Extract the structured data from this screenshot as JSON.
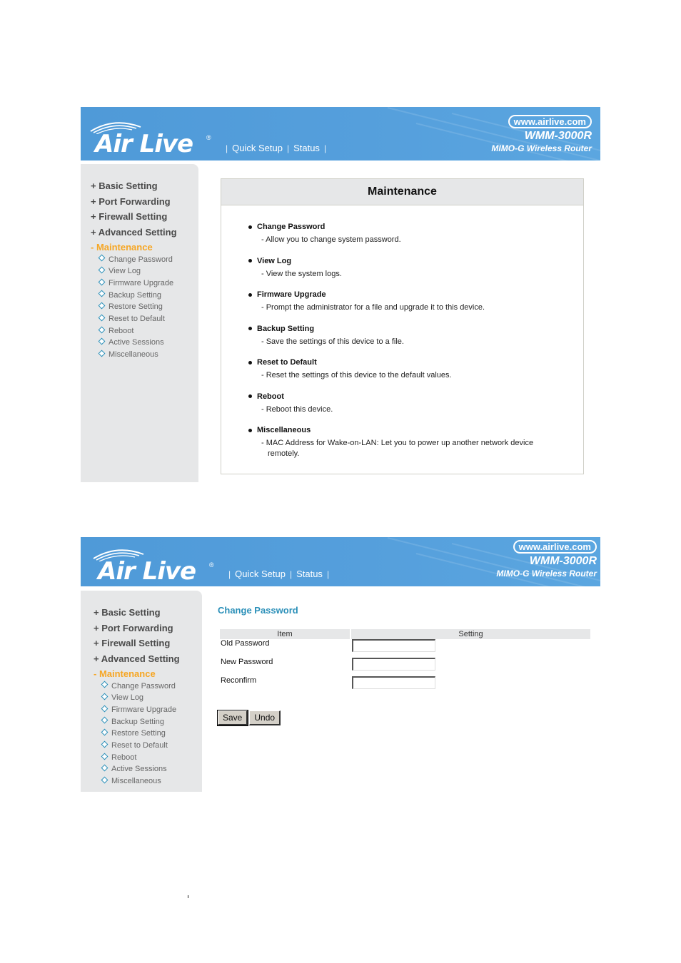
{
  "header": {
    "brand_name": "Air Live",
    "registered_mark": "®",
    "nav": [
      "Quick Setup",
      "Status"
    ],
    "url": "www.airlive.com",
    "model": "WMM-3000R",
    "subtitle": "MIMO-G Wireless Router"
  },
  "sidebar": {
    "menu": [
      {
        "label": "+ Basic Setting",
        "active": false
      },
      {
        "label": "+ Port Forwarding",
        "active": false
      },
      {
        "label": "+ Firewall Setting",
        "active": false
      },
      {
        "label": "+ Advanced Setting",
        "active": false
      },
      {
        "label": "- Maintenance",
        "active": true
      }
    ],
    "submenu": [
      "Change Password",
      "View Log",
      "Firmware Upgrade",
      "Backup Setting",
      "Restore Setting",
      "Reset to Default",
      "Reboot",
      "Active Sessions",
      "Miscellaneous"
    ]
  },
  "maintenance_panel": {
    "title": "Maintenance",
    "entries": [
      {
        "title": "Change Password",
        "desc": "- Allow you to change system password."
      },
      {
        "title": "View Log",
        "desc": "- View the system logs."
      },
      {
        "title": "Firmware Upgrade",
        "desc": "- Prompt the administrator for a file and upgrade it to this device."
      },
      {
        "title": "Backup Setting",
        "desc": "- Save the settings of this device to a file."
      },
      {
        "title": "Reset to Default",
        "desc": "- Reset the settings of this device to the default values."
      },
      {
        "title": "Reboot",
        "desc": "- Reboot this device."
      },
      {
        "title": "Miscellaneous",
        "desc": "- MAC Address for Wake-on-LAN: Let you to power up another network device remotely."
      }
    ]
  },
  "change_password": {
    "title": "Change Password",
    "columns": [
      "Item",
      "Setting"
    ],
    "rows": [
      {
        "label": "Old Password",
        "value": ""
      },
      {
        "label": "New Password",
        "value": ""
      },
      {
        "label": "Reconfirm",
        "value": ""
      }
    ],
    "save_label": "Save",
    "undo_label": "Undo"
  },
  "colors": {
    "banner": "#559fdc",
    "sidebar_bg": "#e6e7e8",
    "active_menu": "#f6a623",
    "accent_title": "#2a8fb8"
  }
}
